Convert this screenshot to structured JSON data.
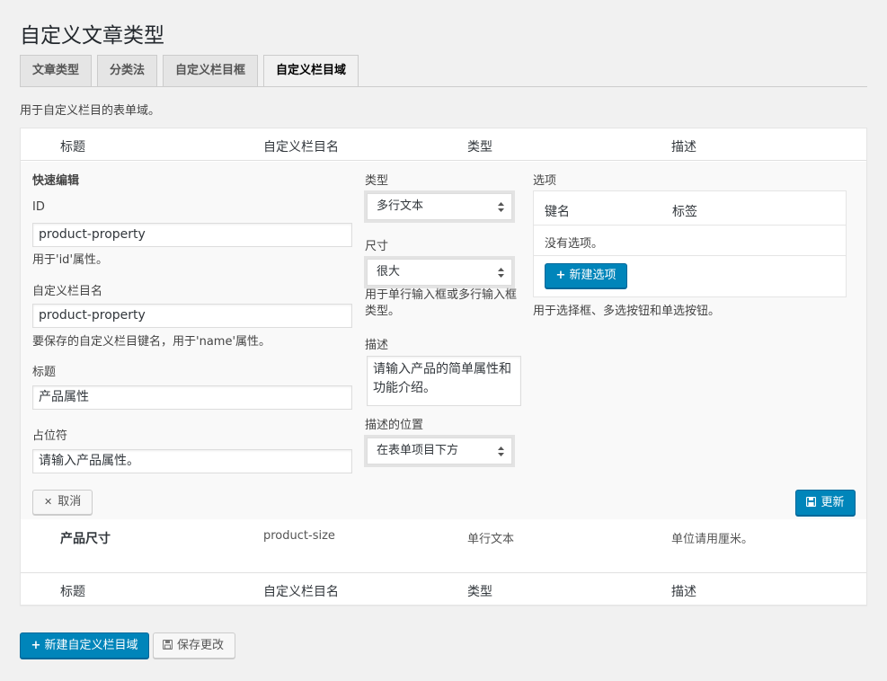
{
  "page": {
    "title": "自定义文章类型"
  },
  "tabs": [
    {
      "label": "文章类型",
      "active": false
    },
    {
      "label": "分类法",
      "active": false
    },
    {
      "label": "自定义栏目框",
      "active": false
    },
    {
      "label": "自定义栏目域",
      "active": true
    }
  ],
  "description": "用于自定义栏目的表单域。",
  "table": {
    "columns": [
      "标题",
      "自定义栏目名",
      "类型",
      "描述"
    ],
    "footer_columns": [
      "标题",
      "自定义栏目名",
      "类型",
      "描述"
    ],
    "rows": [
      {
        "title": "产品尺寸",
        "name": "product-size",
        "type": "单行文本",
        "description": "单位请用厘米。"
      }
    ]
  },
  "quick_edit": {
    "heading": "快速编辑",
    "id_label": "ID",
    "id_value": "product-property",
    "id_help": "用于'id'属性。",
    "name_label": "自定义栏目名",
    "name_value": "product-property",
    "name_help": "要保存的自定义栏目键名，用于'name'属性。",
    "title_label": "标题",
    "title_value": "产品属性",
    "placeholder_label": "占位符",
    "placeholder_value": "请输入产品属性。",
    "type_label": "类型",
    "type_value": "多行文本",
    "size_label": "尺寸",
    "size_value": "很大",
    "size_help": "用于单行输入框或多行输入框类型。",
    "desc_label": "描述",
    "desc_value": "请输入产品的简单属性和功能介绍。",
    "desc_pos_label": "描述的位置",
    "desc_pos_value": "在表单项目下方",
    "options_label": "选项",
    "options_col_key": "键名",
    "options_col_label": "标签",
    "options_empty": "没有选项。",
    "options_add": "新建选项",
    "options_help": "用于选择框、多选按钮和单选按钮。",
    "cancel": "取消",
    "update": "更新"
  },
  "actions": {
    "add_field": "新建自定义栏目域",
    "save": "保存更改"
  }
}
